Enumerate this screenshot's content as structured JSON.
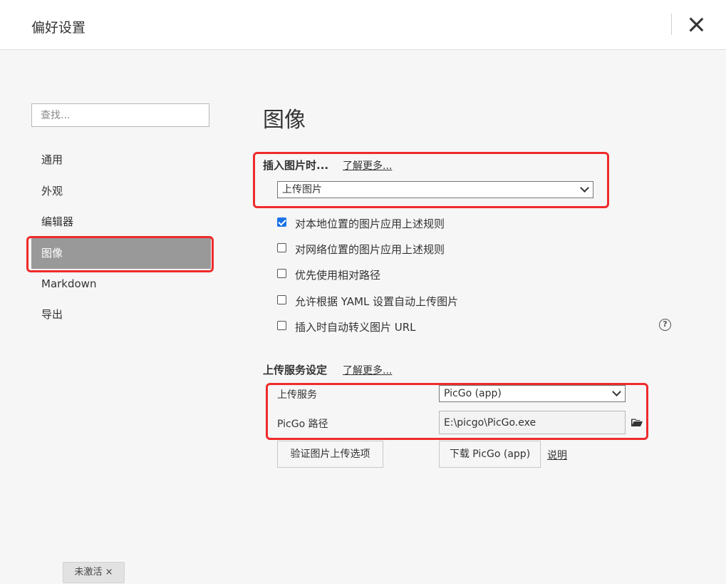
{
  "window": {
    "title": "偏好设置"
  },
  "sidebar": {
    "search_placeholder": "查找...",
    "items": [
      {
        "label": "通用"
      },
      {
        "label": "外观"
      },
      {
        "label": "编辑器"
      },
      {
        "label": "图像",
        "active": true
      },
      {
        "label": "Markdown"
      },
      {
        "label": "导出"
      }
    ]
  },
  "main": {
    "title": "图像",
    "insert": {
      "label": "插入图片时...",
      "learn_more": "了解更多...",
      "selected": "上传图片"
    },
    "options": [
      {
        "label": "对本地位置的图片应用上述规则",
        "checked": true
      },
      {
        "label": "对网络位置的图片应用上述规则",
        "checked": false
      },
      {
        "label": "优先使用相对路径",
        "checked": false
      },
      {
        "label": "允许根据 YAML 设置自动上传图片",
        "checked": false
      },
      {
        "label": "插入时自动转义图片 URL",
        "checked": false
      }
    ],
    "help_icon": "?",
    "upload": {
      "label": "上传服务设定",
      "learn_more": "了解更多...",
      "service_label": "上传服务",
      "service_value": "PicGo (app)",
      "path_label": "PicGo 路径",
      "path_value": "E:\\picgo\\PicGo.exe",
      "verify_button": "验证图片上传选项",
      "download_button": "下载 PicGo (app)",
      "explain_link": "说明"
    }
  },
  "status": {
    "badge": "未激活 ×"
  },
  "colors": {
    "highlight": "#ef2b2b",
    "active_nav": "#999999",
    "checkbox": "#1a73e8"
  },
  "icons": [
    "close-icon",
    "chevron-down-icon",
    "help-icon",
    "folder-icon",
    "checkbox-icon"
  ]
}
